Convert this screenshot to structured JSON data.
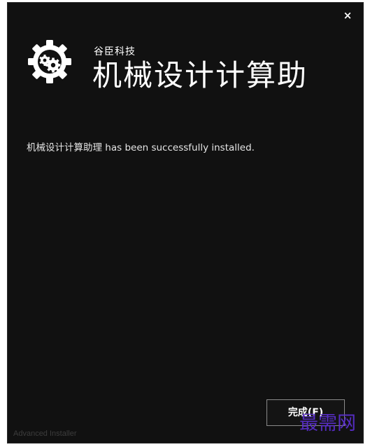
{
  "window": {
    "close_label": "×"
  },
  "header": {
    "logo_icon": "gears-logo-icon",
    "company": "谷臣科技",
    "product": "机械设计计算助"
  },
  "main": {
    "message": "机械设计计算助理 has been successfully installed."
  },
  "footer": {
    "brand": "Advanced Installer",
    "finish_label": "完成(F)"
  },
  "watermark": {
    "text": "最需网"
  },
  "colors": {
    "background": "#111111",
    "text": "#ffffff",
    "watermark": "#5b2fd0"
  }
}
